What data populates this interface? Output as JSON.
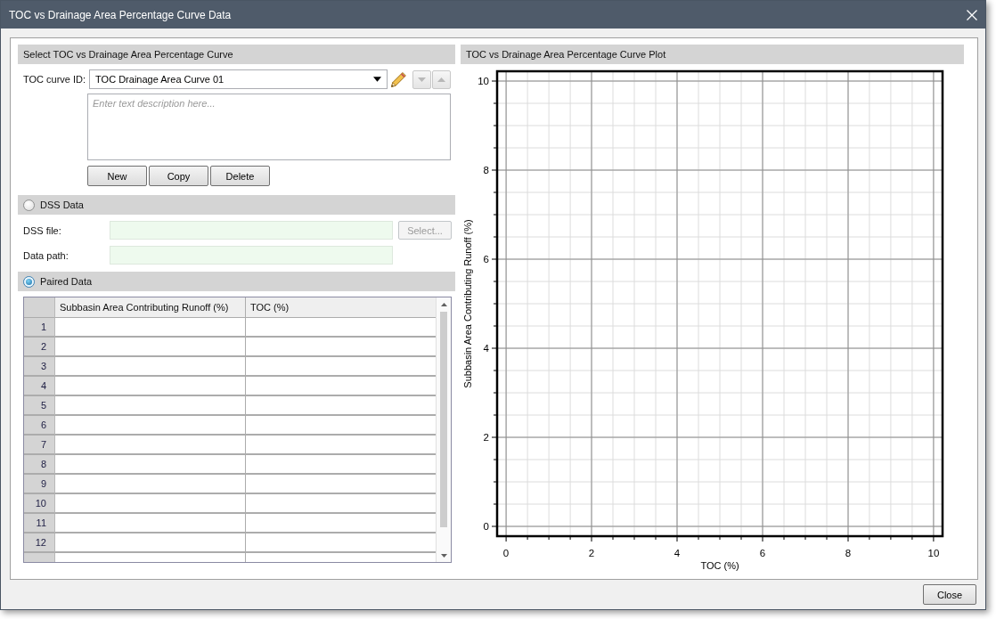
{
  "window": {
    "title": "TOC vs Drainage Area Percentage Curve Data"
  },
  "curve_selection": {
    "header": "Select TOC vs Drainage Area Percentage Curve",
    "curve_id": {
      "label": "TOC curve ID:",
      "value": "TOC Drainage Area Curve 01"
    },
    "move_buttons": [
      {
        "kind": "down",
        "disabled": true
      },
      {
        "kind": "up",
        "disabled": true
      }
    ],
    "description": {
      "placeholder": "Enter text description here..."
    },
    "buttons": [
      {
        "label": "New",
        "disabled": false
      },
      {
        "label": "Copy",
        "disabled": false
      },
      {
        "label": "Delete",
        "disabled": false
      }
    ]
  },
  "dss_data": {
    "label": "DSS Data",
    "selected": false,
    "fields": [
      {
        "label": "DSS file:"
      },
      {
        "label": "Data path:"
      }
    ],
    "select_button": {
      "label": "Select...",
      "disabled": true
    }
  },
  "paired_data": {
    "label": "Paired Data",
    "selected": true,
    "table": {
      "columns": [
        "Subbasin Area Contributing Runoff (%)",
        "TOC (%)"
      ],
      "rows": [
        "1",
        "2",
        "3",
        "4",
        "5",
        "6",
        "7",
        "8",
        "9",
        "10",
        "11",
        "12"
      ]
    }
  },
  "plot": {
    "header": "TOC vs Drainage Area Percentage Curve Plot",
    "chart_data": {
      "type": "line",
      "xlabel": "TOC (%)",
      "ylabel": "Subbasin Area Contributing Runoff (%)",
      "xlim": [
        -0.21,
        10.21
      ],
      "ylim": [
        -0.22,
        10.22
      ],
      "xticks": [
        0,
        2,
        4,
        6,
        8,
        10
      ],
      "yticks": [
        0,
        2,
        4,
        6,
        8,
        10
      ],
      "grid": true
    }
  },
  "footer": {
    "buttons": [
      "Close"
    ]
  }
}
